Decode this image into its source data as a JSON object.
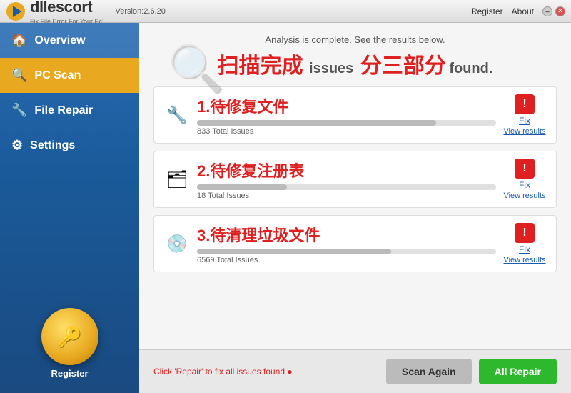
{
  "app": {
    "name": "dllescort",
    "tagline": "Fix File Error For Your Pc!",
    "version": "Version:2.6.20"
  },
  "titlebar": {
    "register_label": "Register",
    "about_label": "About",
    "min_btn": "–",
    "close_btn": "✕"
  },
  "sidebar": {
    "items": [
      {
        "id": "overview",
        "label": "Overview"
      },
      {
        "id": "pc-scan",
        "label": "PC Scan"
      },
      {
        "id": "file-repair",
        "label": "File Repair"
      },
      {
        "id": "settings",
        "label": "Settings"
      }
    ],
    "register_label": "Register"
  },
  "content": {
    "analysis_complete": "Analysis is complete. See the results below.",
    "scan_complete_text": "扫描完成",
    "issues_text": "issues",
    "found_text": "found.",
    "three_parts_text": "分三部分",
    "results": [
      {
        "id": "file-repair",
        "title": "1.待修复文件",
        "count": "833 Total Issues",
        "progress": 80,
        "fix_label": "Fix",
        "view_label": "View results"
      },
      {
        "id": "registry",
        "title": "2.待修复注册表",
        "count": "18 Total Issues",
        "progress": 30,
        "fix_label": "Fix",
        "view_label": "View results"
      },
      {
        "id": "disk",
        "title": "3.待清理垃圾文件",
        "count": "6569 Total Issues",
        "progress": 65,
        "fix_label": "Fix",
        "view_label": "View results"
      }
    ]
  },
  "footer": {
    "hint": "Click 'Repair' to fix all issues found",
    "scan_again_label": "Scan Again",
    "all_repair_label": "All Repair"
  }
}
